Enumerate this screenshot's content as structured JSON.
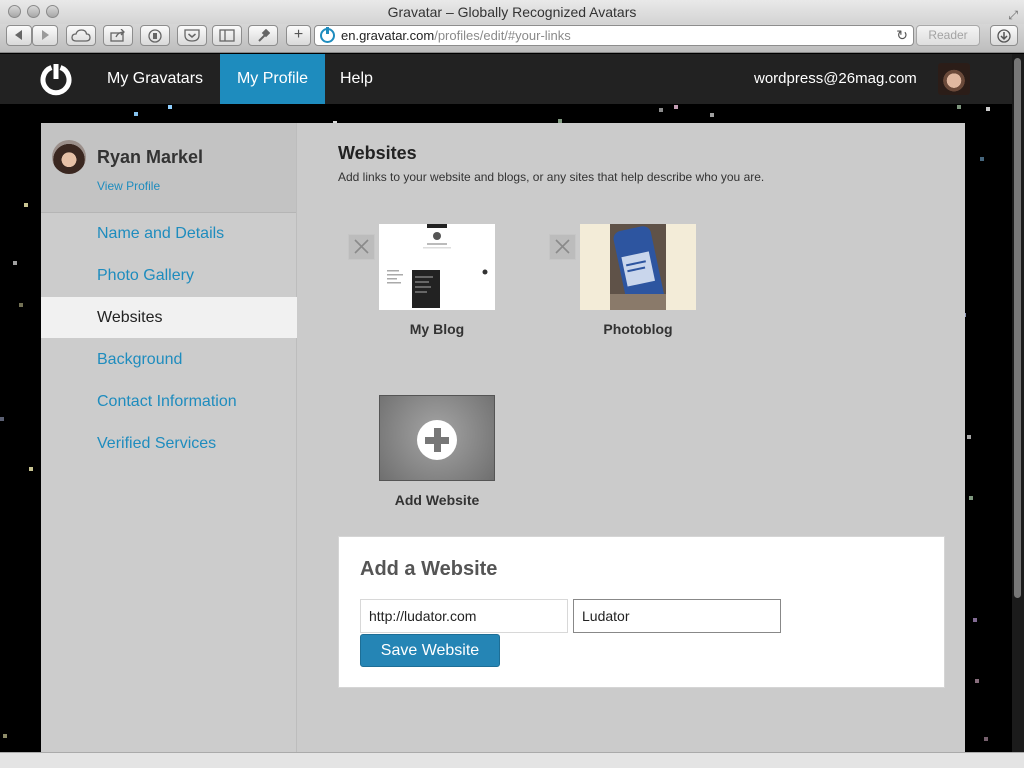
{
  "browser": {
    "window_title": "Gravatar – Globally Recognized Avatars",
    "url_host": "en.gravatar.com",
    "url_path": "/profiles/edit/#your-links",
    "reader_label": "Reader"
  },
  "nav": {
    "items": [
      {
        "label": "My Gravatars"
      },
      {
        "label": "My Profile"
      },
      {
        "label": "Help"
      }
    ],
    "email": "wordpress@26mag.com"
  },
  "sidebar": {
    "name": "Ryan Markel",
    "view_profile": "View Profile",
    "items": [
      {
        "label": "Name and Details"
      },
      {
        "label": "Photo Gallery"
      },
      {
        "label": "Websites"
      },
      {
        "label": "Background"
      },
      {
        "label": "Contact Information"
      },
      {
        "label": "Verified Services"
      }
    ]
  },
  "main": {
    "title": "Websites",
    "description": "Add links to your website and blogs, or any sites that help describe who you are.",
    "websites": [
      {
        "label": "My Blog"
      },
      {
        "label": "Photoblog"
      }
    ],
    "add_website_label": "Add Website"
  },
  "form": {
    "title": "Add a Website",
    "url_value": "http://ludator.com",
    "name_value": "Ludator",
    "save_label": "Save Website"
  },
  "colors": {
    "accent": "#1e8cbe",
    "nav_bg": "#222222",
    "panel_bg": "#cbcbcb"
  }
}
